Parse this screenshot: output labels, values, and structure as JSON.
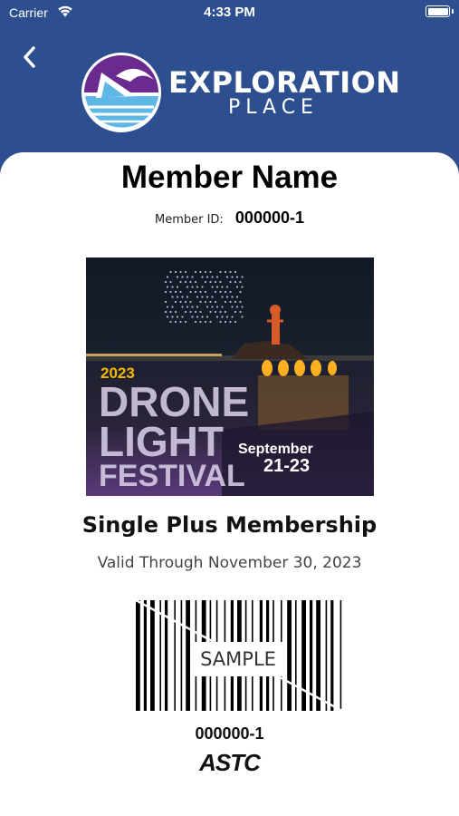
{
  "status_bar": {
    "carrier": "Carrier",
    "time": "4:33 PM"
  },
  "header": {
    "logo_word_1": "EXPLORATION",
    "logo_word_2": "PLACE",
    "background_color": "#2d4f8f"
  },
  "member": {
    "name": "Member Name",
    "id_label": "Member ID:",
    "id_value": "000000-1"
  },
  "promo": {
    "year": "2023",
    "line_1": "DRONE",
    "line_2": "LIGHT",
    "line_3": "FESTIVAL",
    "date_line_1": "September",
    "date_line_2": "21-23"
  },
  "membership": {
    "plan": "Single Plus Membership",
    "valid_through": "Valid Through November 30, 2023"
  },
  "barcode": {
    "overlay_text": "SAMPLE",
    "number": "000000-1"
  },
  "footer": {
    "astc_logo_text": "ASTC"
  },
  "icons": [
    "back-chevron-icon",
    "wifi-icon",
    "battery-icon",
    "exploration-place-logo-icon"
  ]
}
